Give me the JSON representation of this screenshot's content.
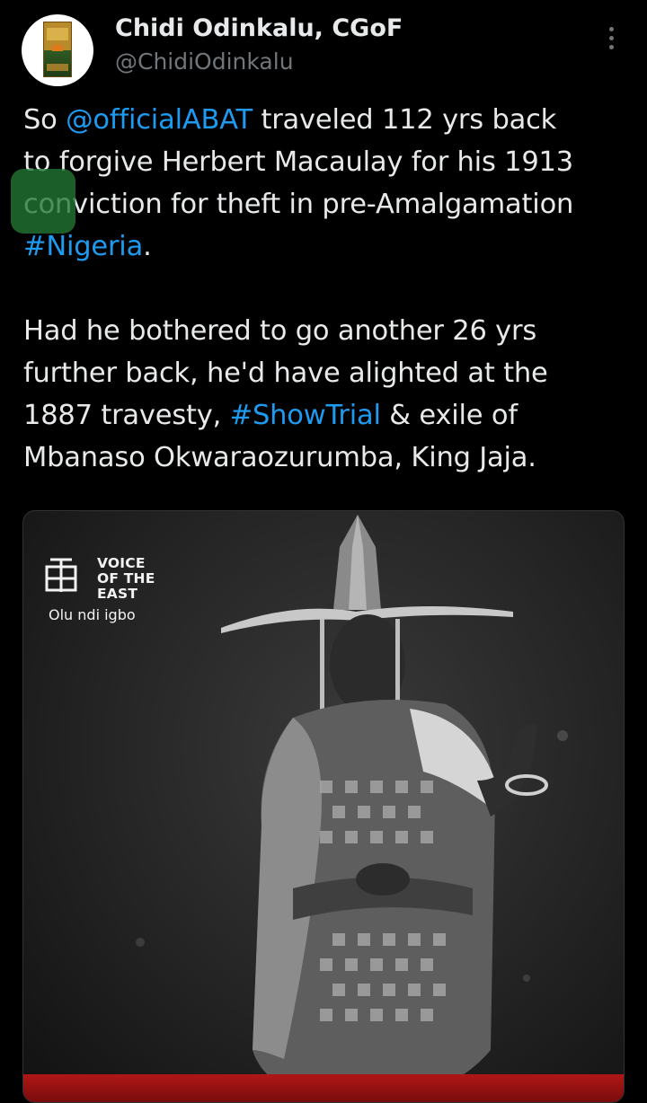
{
  "author": {
    "display_name": "Chidi Odinkalu, CGoF",
    "handle": "@ChidiOdinkalu",
    "avatar_icon": "book-cover-avatar"
  },
  "more_icon": "more-options-icon",
  "tweet": {
    "p1": {
      "l1_pre": "So ",
      "mention": "@officialABAT",
      "l1_post": " traveled 112 yrs back",
      "l2": "to forgive Herbert Macaulay for his 1913",
      "l3": "conviction for theft in pre-Amalgamation",
      "hashtag": "#Nigeria",
      "l4_post": "."
    },
    "p2": {
      "l1": "Had he bothered to go another 26 yrs",
      "l2": "further back, he'd have alighted at the",
      "l3_pre": "1887 travesty, ",
      "hashtag": "#ShowTrial",
      "l3_post": " & exile of",
      "l4": "Mbanaso Okwaraozurumba, King Jaja."
    }
  },
  "media": {
    "watermark": {
      "lines": [
        "VOICE",
        "OF THE",
        "EAST"
      ],
      "tagline": "Olu ndi igbo"
    }
  },
  "colors": {
    "background": "#000000",
    "text": "#e7e9ea",
    "muted": "#71767b",
    "link": "#1d9bf0",
    "floating_button": "#22783a",
    "media_bar": "#b01717"
  }
}
